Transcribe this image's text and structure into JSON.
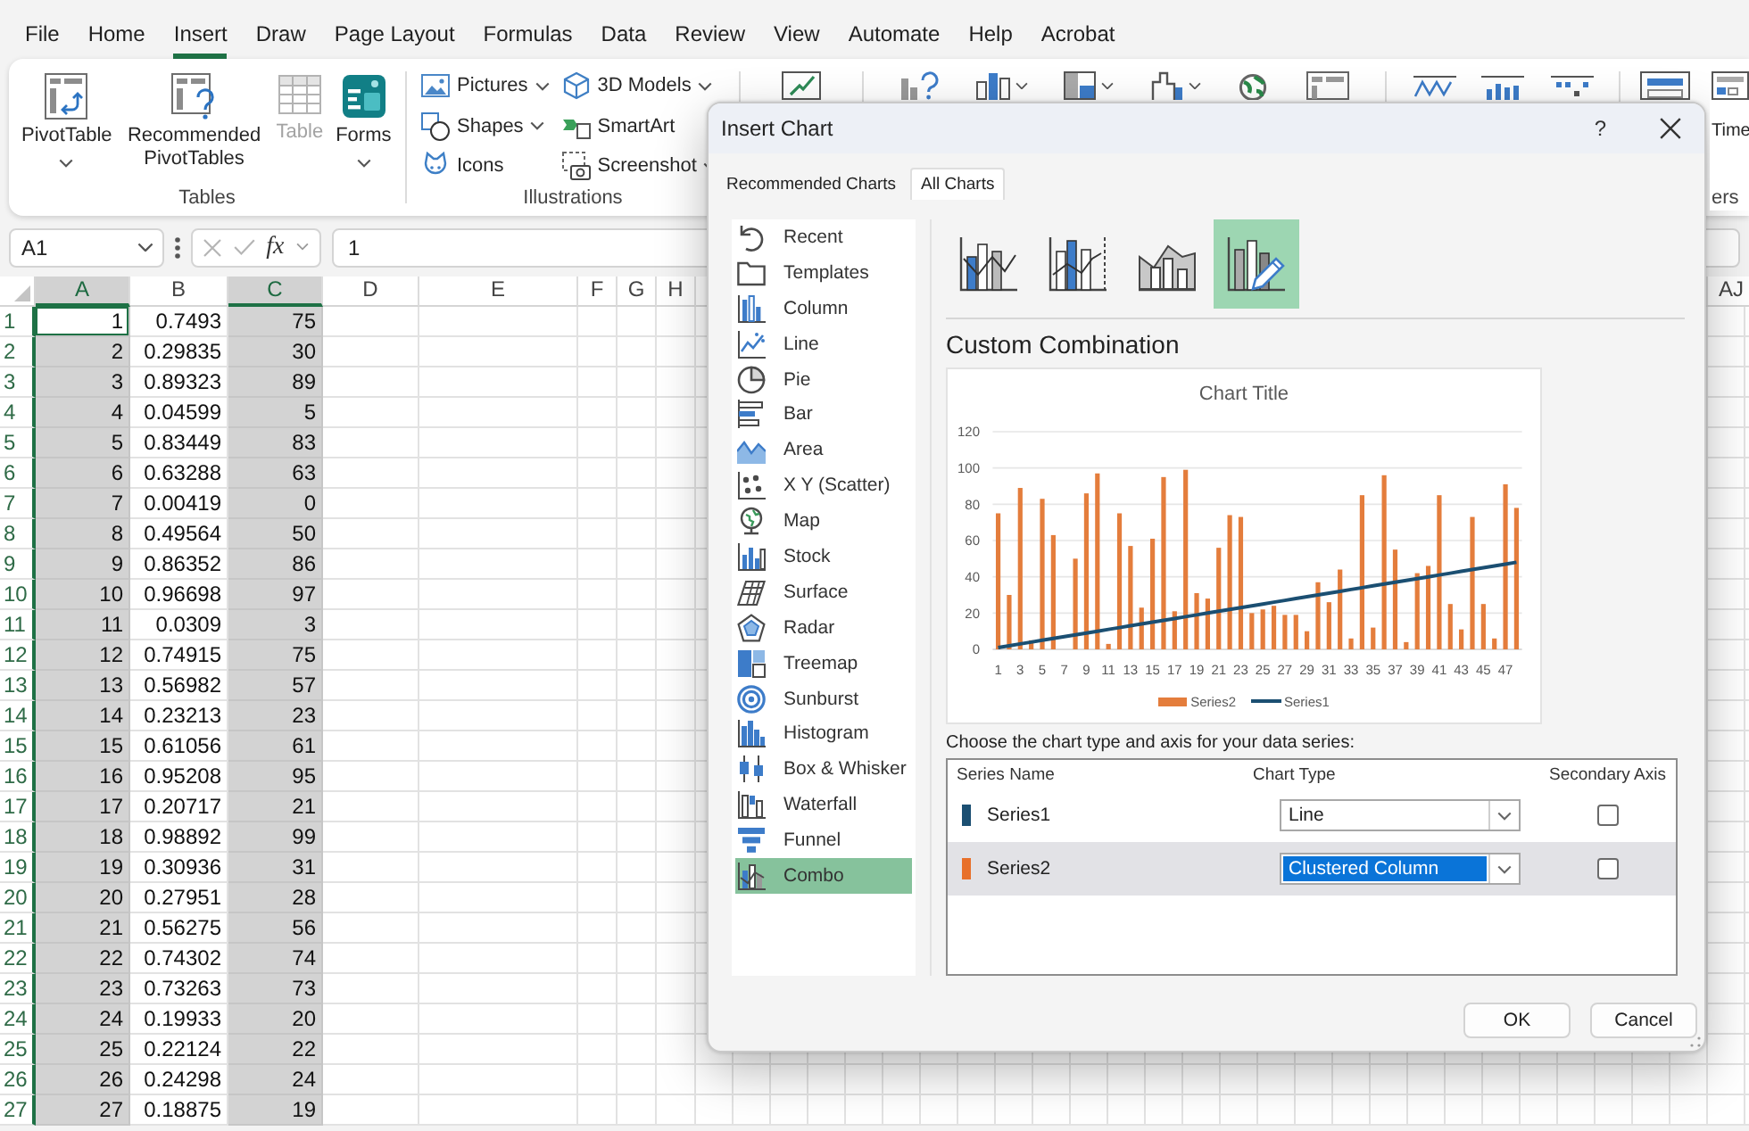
{
  "menu_tabs": [
    {
      "label": "File",
      "selected": false
    },
    {
      "label": "Home",
      "selected": false
    },
    {
      "label": "Insert",
      "selected": true
    },
    {
      "label": "Draw",
      "selected": false
    },
    {
      "label": "Page Layout",
      "selected": false
    },
    {
      "label": "Formulas",
      "selected": false
    },
    {
      "label": "Data",
      "selected": false
    },
    {
      "label": "Review",
      "selected": false
    },
    {
      "label": "View",
      "selected": false
    },
    {
      "label": "Automate",
      "selected": false
    },
    {
      "label": "Help",
      "selected": false
    },
    {
      "label": "Acrobat",
      "selected": false
    }
  ],
  "ribbon": {
    "groups": [
      {
        "kind": "large",
        "label": "Tables",
        "buttons": [
          {
            "label": "PivotTable",
            "dropdown": true,
            "disabled": false
          },
          {
            "label": "Recommended PivotTables",
            "dropdown": false,
            "disabled": false
          },
          {
            "label": "Table",
            "dropdown": false,
            "disabled": true
          },
          {
            "label": "Forms",
            "dropdown": true,
            "disabled": false
          }
        ]
      },
      {
        "kind": "small",
        "label": "Illustrations",
        "buttons": [
          {
            "label": "Pictures",
            "dropdown": true
          },
          {
            "label": "Shapes",
            "dropdown": true
          },
          {
            "label": "Icons",
            "dropdown": false
          },
          {
            "label": "3D Models",
            "dropdown": true
          },
          {
            "label": "SmartArt",
            "dropdown": false
          },
          {
            "label": "Screenshot",
            "dropdown": true
          }
        ]
      }
    ],
    "cut_off_button": {
      "label": "Time"
    },
    "cut_off_group_label": "ers"
  },
  "formula_bar": {
    "name_box": "A1",
    "function_button": "fx",
    "formula": "1"
  },
  "sheet": {
    "columns": [
      {
        "label": "A",
        "selected": true
      },
      {
        "label": "B",
        "selected": false
      },
      {
        "label": "C",
        "selected": true
      },
      {
        "label": "D",
        "selected": false
      },
      {
        "label": "E",
        "selected": false
      },
      {
        "label": "F",
        "selected": false
      },
      {
        "label": "G",
        "selected": false
      },
      {
        "label": "H",
        "selected": false
      }
    ],
    "far_right_column": {
      "label": "AJ"
    },
    "rows": [
      {
        "header": "1",
        "selected": true,
        "active": true,
        "cells": [
          "1",
          "0.7493",
          "75"
        ]
      },
      {
        "header": "2",
        "selected": true,
        "active": false,
        "cells": [
          "2",
          "0.29835",
          "30"
        ]
      },
      {
        "header": "3",
        "selected": true,
        "active": false,
        "cells": [
          "3",
          "0.89323",
          "89"
        ]
      },
      {
        "header": "4",
        "selected": true,
        "active": false,
        "cells": [
          "4",
          "0.04599",
          "5"
        ]
      },
      {
        "header": "5",
        "selected": true,
        "active": false,
        "cells": [
          "5",
          "0.83449",
          "83"
        ]
      },
      {
        "header": "6",
        "selected": true,
        "active": false,
        "cells": [
          "6",
          "0.63288",
          "63"
        ]
      },
      {
        "header": "7",
        "selected": true,
        "active": false,
        "cells": [
          "7",
          "0.00419",
          "0"
        ]
      },
      {
        "header": "8",
        "selected": true,
        "active": false,
        "cells": [
          "8",
          "0.49564",
          "50"
        ]
      },
      {
        "header": "9",
        "selected": true,
        "active": false,
        "cells": [
          "9",
          "0.86352",
          "86"
        ]
      },
      {
        "header": "10",
        "selected": true,
        "active": false,
        "cells": [
          "10",
          "0.96698",
          "97"
        ]
      },
      {
        "header": "11",
        "selected": true,
        "active": false,
        "cells": [
          "11",
          "0.0309",
          "3"
        ]
      },
      {
        "header": "12",
        "selected": true,
        "active": false,
        "cells": [
          "12",
          "0.74915",
          "75"
        ]
      },
      {
        "header": "13",
        "selected": true,
        "active": false,
        "cells": [
          "13",
          "0.56982",
          "57"
        ]
      },
      {
        "header": "14",
        "selected": true,
        "active": false,
        "cells": [
          "14",
          "0.23213",
          "23"
        ]
      },
      {
        "header": "15",
        "selected": true,
        "active": false,
        "cells": [
          "15",
          "0.61056",
          "61"
        ]
      },
      {
        "header": "16",
        "selected": true,
        "active": false,
        "cells": [
          "16",
          "0.95208",
          "95"
        ]
      },
      {
        "header": "17",
        "selected": true,
        "active": false,
        "cells": [
          "17",
          "0.20717",
          "21"
        ]
      },
      {
        "header": "18",
        "selected": true,
        "active": false,
        "cells": [
          "18",
          "0.98892",
          "99"
        ]
      },
      {
        "header": "19",
        "selected": true,
        "active": false,
        "cells": [
          "19",
          "0.30936",
          "31"
        ]
      },
      {
        "header": "20",
        "selected": true,
        "active": false,
        "cells": [
          "20",
          "0.27951",
          "28"
        ]
      },
      {
        "header": "21",
        "selected": true,
        "active": false,
        "cells": [
          "21",
          "0.56275",
          "56"
        ]
      },
      {
        "header": "22",
        "selected": true,
        "active": false,
        "cells": [
          "22",
          "0.74302",
          "74"
        ]
      },
      {
        "header": "23",
        "selected": true,
        "active": false,
        "cells": [
          "23",
          "0.73263",
          "73"
        ]
      },
      {
        "header": "24",
        "selected": true,
        "active": false,
        "cells": [
          "24",
          "0.19933",
          "20"
        ]
      },
      {
        "header": "25",
        "selected": true,
        "active": false,
        "cells": [
          "25",
          "0.22124",
          "22"
        ]
      },
      {
        "header": "26",
        "selected": true,
        "active": false,
        "cells": [
          "26",
          "0.24298",
          "24"
        ]
      },
      {
        "header": "27",
        "selected": true,
        "active": false,
        "cells": [
          "27",
          "0.18875",
          "19"
        ]
      }
    ]
  },
  "dialog": {
    "title": "Insert Chart",
    "help": "?",
    "tabs": [
      {
        "label": "Recommended Charts",
        "selected": false
      },
      {
        "label": "All Charts",
        "selected": true
      }
    ],
    "chart_types": [
      {
        "label": "Recent",
        "selected": false
      },
      {
        "label": "Templates",
        "selected": false
      },
      {
        "label": "Column",
        "selected": false
      },
      {
        "label": "Line",
        "selected": false
      },
      {
        "label": "Pie",
        "selected": false
      },
      {
        "label": "Bar",
        "selected": false
      },
      {
        "label": "Area",
        "selected": false
      },
      {
        "label": "X Y (Scatter)",
        "selected": false
      },
      {
        "label": "Map",
        "selected": false
      },
      {
        "label": "Stock",
        "selected": false
      },
      {
        "label": "Surface",
        "selected": false
      },
      {
        "label": "Radar",
        "selected": false
      },
      {
        "label": "Treemap",
        "selected": false
      },
      {
        "label": "Sunburst",
        "selected": false
      },
      {
        "label": "Histogram",
        "selected": false
      },
      {
        "label": "Box & Whisker",
        "selected": false
      },
      {
        "label": "Waterfall",
        "selected": false
      },
      {
        "label": "Funnel",
        "selected": false
      },
      {
        "label": "Combo",
        "selected": true
      }
    ],
    "subtypes": [
      {
        "selected": false
      },
      {
        "selected": false
      },
      {
        "selected": false
      },
      {
        "selected": true
      }
    ],
    "subtype_title": "Custom Combination",
    "preview": {
      "chart_data": {
        "type": "bar",
        "title": "Chart Title",
        "x": [
          1,
          2,
          3,
          4,
          5,
          6,
          7,
          8,
          9,
          10,
          11,
          12,
          13,
          14,
          15,
          16,
          17,
          18,
          19,
          20,
          21,
          22,
          23,
          24,
          25,
          26,
          27,
          28,
          29,
          30,
          31,
          32,
          33,
          34,
          35,
          36,
          37,
          38,
          39,
          40,
          41,
          42,
          43,
          44,
          45,
          46,
          47,
          48
        ],
        "xlim": [
          0.5,
          48.5
        ],
        "xticks": [
          1,
          3,
          5,
          7,
          9,
          11,
          13,
          15,
          17,
          19,
          21,
          23,
          25,
          27,
          29,
          31,
          33,
          35,
          37,
          39,
          41,
          43,
          45,
          47
        ],
        "ylim": [
          0,
          120
        ],
        "yticks": [
          0,
          20,
          40,
          60,
          80,
          100,
          120
        ],
        "grid": true,
        "legend": "bottom",
        "series": [
          {
            "name": "Series2",
            "type": "bar",
            "color": "#e47d3c",
            "values": [
              75,
              30,
              89,
              5,
              83,
              63,
              0,
              50,
              86,
              97,
              3,
              75,
              57,
              23,
              61,
              95,
              21,
              99,
              31,
              28,
              56,
              74,
              73,
              20,
              22,
              24,
              19,
              19,
              10,
              37,
              26,
              44,
              6,
              85,
              12,
              96,
              55,
              4,
              42,
              46,
              85,
              25,
              11,
              73,
              25,
              6,
              91,
              78
            ]
          },
          {
            "name": "Series1",
            "type": "line",
            "color": "#1b4f72",
            "values": [
              1,
              2,
              3,
              4,
              5,
              6,
              7,
              8,
              9,
              10,
              11,
              12,
              13,
              14,
              15,
              16,
              17,
              18,
              19,
              20,
              21,
              22,
              23,
              24,
              25,
              26,
              27,
              28,
              29,
              30,
              31,
              32,
              33,
              34,
              35,
              36,
              37,
              38,
              39,
              40,
              41,
              42,
              43,
              44,
              45,
              46,
              47,
              48
            ]
          }
        ]
      }
    },
    "series_prompt": "Choose the chart type and axis for your data series:",
    "series_table": {
      "columns": [
        "Series Name",
        "Chart Type",
        "Secondary Axis"
      ],
      "rows": [
        {
          "name": "Series1",
          "color": "#1b4f72",
          "chart_type": "Line",
          "secondary_axis": false,
          "selected": false
        },
        {
          "name": "Series2",
          "color": "#e8702a",
          "chart_type": "Clustered Column",
          "secondary_axis": false,
          "selected": true
        }
      ]
    },
    "buttons": [
      "OK",
      "Cancel"
    ]
  }
}
